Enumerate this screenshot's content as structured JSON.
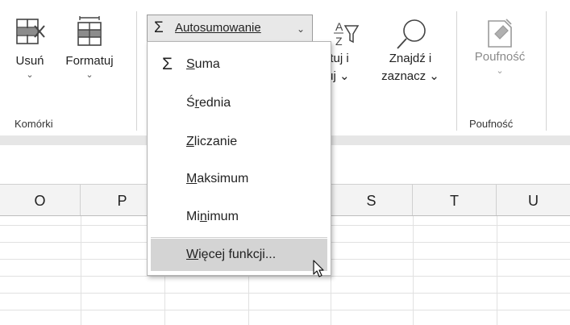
{
  "ribbon": {
    "usun_label": "Usuń",
    "formatuj_label": "Formatuj",
    "chevron": "⌄",
    "group_komorki": "Komórki",
    "sortuj_line1": "ortuj i",
    "sortuj_line2": "truj ⌄",
    "znajdz_line1": "Znajdź i",
    "znajdz_line2": "zaznacz ⌄",
    "poufnosc_label": "Poufność",
    "group_poufnosc": "Poufność"
  },
  "autosum": {
    "label": "Autosumowanie",
    "sigma": "Σ",
    "chevron": "⌄"
  },
  "menu": {
    "items": [
      {
        "pre": "",
        "u": "S",
        "post": "uma"
      },
      {
        "pre": "Ś",
        "u": "r",
        "post": "ednia"
      },
      {
        "pre": "",
        "u": "Z",
        "post": "liczanie"
      },
      {
        "pre": "",
        "u": "M",
        "post": "aksimum"
      },
      {
        "pre": "Mi",
        "u": "n",
        "post": "imum"
      },
      {
        "pre": "",
        "u": "W",
        "post": "ięcej funkcji..."
      }
    ]
  },
  "columns": [
    "O",
    "P",
    "",
    "",
    "S",
    "T",
    "U"
  ],
  "colors": {
    "ribbon_bg": "#ffffff",
    "band": "#e6e6e6",
    "header_bg": "#f3f3f3",
    "highlight": "#d4d4d4"
  }
}
